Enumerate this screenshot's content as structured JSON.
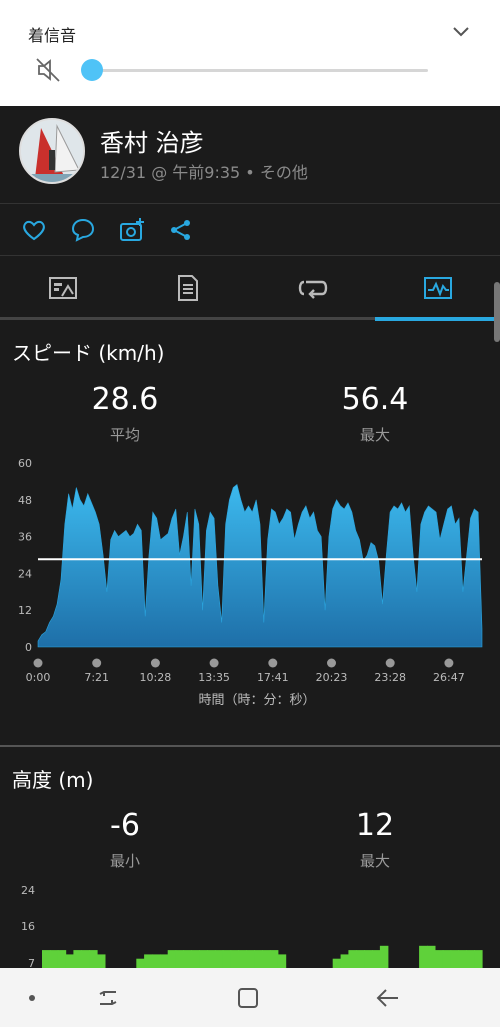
{
  "volume": {
    "title": "着信音",
    "level": 0
  },
  "post": {
    "user_name": "香村 治彦",
    "meta": "12/31 @ 午前9:35 • その他"
  },
  "tabs": [
    {
      "icon": "summary-icon",
      "active": false
    },
    {
      "icon": "details-icon",
      "active": false
    },
    {
      "icon": "laps-icon",
      "active": false
    },
    {
      "icon": "chart-icon",
      "active": true
    }
  ],
  "speed": {
    "title": "スピード (km/h)",
    "avg_value": "28.6",
    "avg_label": "平均",
    "max_value": "56.4",
    "max_label": "最大",
    "xlabel": "時間（時：分：秒）"
  },
  "elevation": {
    "title": "高度 (m)",
    "min_value": "-6",
    "min_label": "最小",
    "max_value": "12",
    "max_label": "最大"
  },
  "chart_data": [
    {
      "type": "area",
      "ylim": [
        0,
        60
      ],
      "yticks": [
        "0",
        "12",
        "24",
        "36",
        "48",
        "60"
      ],
      "xticks": [
        "0:00",
        "7:21",
        "10:28",
        "13:35",
        "17:41",
        "20:23",
        "23:28",
        "26:47"
      ],
      "avg_line": 28.6,
      "color": "#2aa5df",
      "values": [
        2,
        4,
        5,
        8,
        10,
        14,
        22,
        40,
        50,
        45,
        52,
        48,
        46,
        50,
        47,
        44,
        40,
        30,
        18,
        35,
        38,
        36,
        37,
        38,
        36,
        37,
        40,
        38,
        10,
        30,
        44,
        42,
        35,
        36,
        37,
        42,
        45,
        30,
        36,
        44,
        20,
        45,
        40,
        12,
        38,
        44,
        42,
        20,
        8,
        40,
        48,
        52,
        53,
        48,
        44,
        46,
        44,
        48,
        40,
        8,
        35,
        45,
        44,
        40,
        42,
        45,
        44,
        35,
        40,
        44,
        46,
        42,
        44,
        38,
        36,
        12,
        36,
        45,
        48,
        46,
        45,
        47,
        44,
        38,
        35,
        28,
        30,
        34,
        33,
        28,
        14,
        30,
        44,
        46,
        45,
        47,
        44,
        46,
        30,
        18,
        40,
        44,
        46,
        45,
        44,
        35,
        40,
        45,
        46,
        40,
        42,
        18,
        30,
        42,
        45,
        44,
        6
      ]
    },
    {
      "type": "area",
      "ylim": [
        7,
        24
      ],
      "yticks": [
        "7",
        "16",
        "24"
      ],
      "color": "#5fd13a",
      "values": [
        10,
        10,
        10,
        9,
        10,
        10,
        10,
        9,
        0,
        0,
        0,
        0,
        8,
        9,
        9,
        9,
        10,
        10,
        10,
        10,
        10,
        10,
        10,
        10,
        10,
        10,
        10,
        10,
        10,
        10,
        9,
        0,
        0,
        0,
        0,
        0,
        0,
        8,
        9,
        10,
        10,
        10,
        10,
        11,
        0,
        0,
        0,
        0,
        11,
        11,
        10,
        10,
        10,
        10,
        10,
        10
      ]
    }
  ]
}
